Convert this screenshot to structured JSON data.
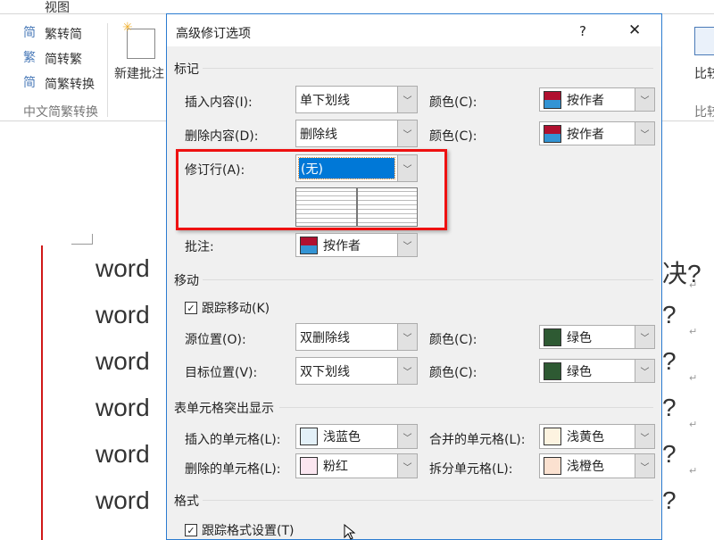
{
  "ribbon": {
    "tab_view": "视图",
    "btn_trad_to_simp": "繁转简",
    "btn_simp_to_trad": "简转繁",
    "btn_convert": "简繁转换",
    "group_chinese": "中文简繁转换",
    "btn_new_comment": "新建批注",
    "btn_compare": "比较",
    "group_compare": "比较"
  },
  "document": {
    "lines": [
      "word",
      "word",
      "word",
      "word",
      "word",
      "word"
    ],
    "first_line_end": "决?",
    "line_end": "?",
    "para_mark": "↵"
  },
  "dialog": {
    "title": "高级修订选项",
    "help": "?",
    "close": "✕",
    "markup": {
      "heading": "标记",
      "insert_label": "插入内容(I):",
      "insert_value": "单下划线",
      "insert_color_label": "颜色(C):",
      "insert_color_value": "按作者",
      "delete_label": "删除内容(D):",
      "delete_value": "删除线",
      "delete_color_label": "颜色(C):",
      "delete_color_value": "按作者",
      "changed_lines_label": "修订行(A):",
      "changed_lines_value": "(无)",
      "comments_label": "批注:",
      "comments_value": "按作者"
    },
    "moves": {
      "heading": "移动",
      "track_moves_label": "跟踪移动(K)",
      "track_moves_checked": true,
      "from_label": "源位置(O):",
      "from_value": "双删除线",
      "from_color_label": "颜色(C):",
      "from_color_value": "绿色",
      "to_label": "目标位置(V):",
      "to_value": "双下划线",
      "to_color_label": "颜色(C):",
      "to_color_value": "绿色"
    },
    "table": {
      "heading": "表单元格突出显示",
      "inserted_label": "插入的单元格(L):",
      "inserted_value": "浅蓝色",
      "merged_label": "合并的单元格(L):",
      "merged_value": "浅黄色",
      "deleted_label": "删除的单元格(L):",
      "deleted_value": "粉红",
      "split_label": "拆分单元格(L):",
      "split_value": "浅橙色"
    },
    "formatting": {
      "heading": "格式",
      "track_format_label": "跟踪格式设置(T)",
      "track_format_checked": true
    }
  },
  "colors": {
    "author_top": "#b0102f",
    "author_bottom": "#3394d4",
    "green": "#2e5a33",
    "light_blue": "#e3f0f8",
    "light_yellow": "#fdf3e0",
    "pink": "#fbe6f0",
    "light_orange": "#fbe1d0",
    "highlight": "#0078d7",
    "red_box": "#e11"
  }
}
